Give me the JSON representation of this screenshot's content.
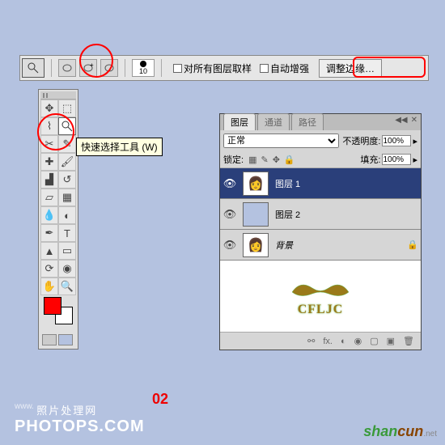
{
  "options_bar": {
    "brush_size": "10",
    "sample_all_label": "对所有图层取样",
    "auto_enhance_label": "自动增强",
    "refine_edge_label": "调整边缘…"
  },
  "tooltip": "快速选择工具 (W)",
  "layers_panel": {
    "tabs": {
      "layers": "图层",
      "channels": "通道",
      "paths": "路径"
    },
    "blend_mode": "正常",
    "opacity_label": "不透明度:",
    "opacity_value": "100%",
    "lock_label": "锁定:",
    "fill_label": "填充:",
    "fill_value": "100%",
    "items": [
      {
        "name": "图层 1",
        "active": true,
        "visible": true,
        "thumb_color": "#fff"
      },
      {
        "name": "图层 2",
        "active": false,
        "visible": true,
        "thumb_color": "#b4c2e0"
      },
      {
        "name": "背景",
        "active": false,
        "visible": true,
        "locked": true,
        "thumb_color": "#fff",
        "italic": true
      }
    ],
    "logo_text": "CFLJC"
  },
  "step": "02",
  "watermark": {
    "www": "www.",
    "cn": "照片处理网",
    "en": "PHOTOPS.COM"
  },
  "shancun": {
    "part1": "shan",
    "part2": "cun",
    "tld": ".net"
  },
  "colors": {
    "fg": "#ff0000",
    "bg": "#ffffff"
  }
}
